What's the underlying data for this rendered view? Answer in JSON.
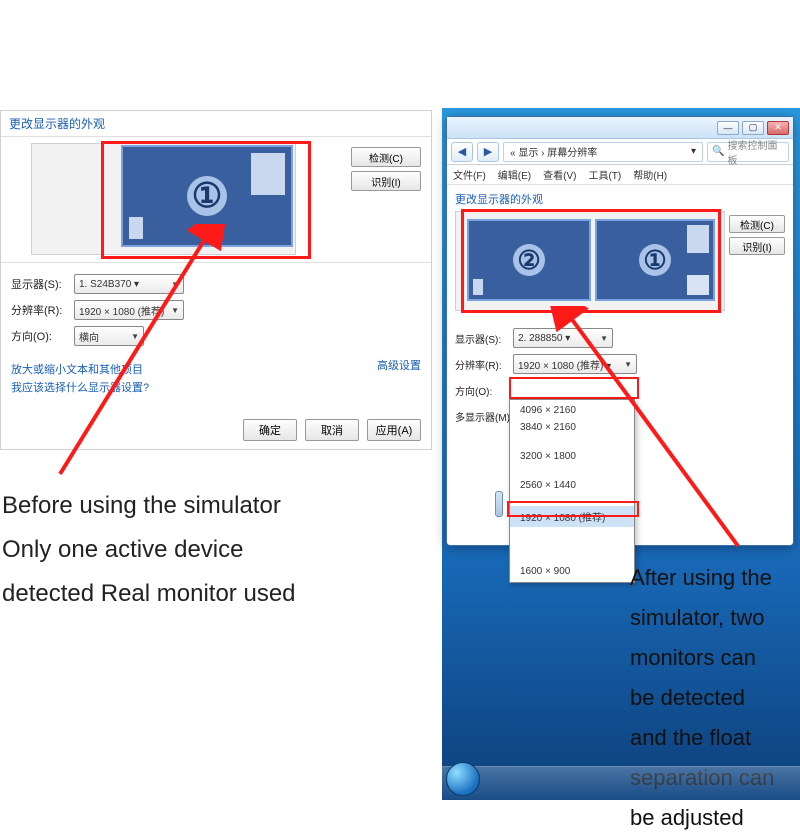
{
  "left": {
    "title": "更改显示器的外观",
    "buttons": {
      "detect": "检测(C)",
      "identify": "识别(I)"
    },
    "fields": {
      "display_label": "显示器(S):",
      "display_value": "1. S24B370 ▾",
      "resolution_label": "分辨率(R):",
      "resolution_value": "1920 × 1080 (推荐)",
      "orientation_label": "方向(O):",
      "orientation_value": "横向"
    },
    "adv_link": "高级设置",
    "help_link1": "放大或缩小文本和其他项目",
    "help_link2": "我应该选择什么显示器设置?",
    "bottom": {
      "ok": "确定",
      "cancel": "取消",
      "apply": "应用(A)"
    }
  },
  "caption_left_l1": "Before using the simulator",
  "caption_left_l2": "Only one active device",
  "caption_left_l3": "detected Real monitor used",
  "right": {
    "breadcrumb": "« 显示 › 屏幕分辨率",
    "search_placeholder": "搜索控制面板",
    "menu": {
      "file": "文件(F)",
      "edit": "编辑(E)",
      "view": "查看(V)",
      "tools": "工具(T)",
      "help": "帮助(H)"
    },
    "section_title": "更改显示器的外观",
    "buttons": {
      "detect": "检测(C)",
      "identify": "识别(I)"
    },
    "fields": {
      "display_label": "显示器(S):",
      "display_value": "2. 288850 ▾",
      "resolution_label": "分辨率(R):",
      "resolution_value": "1920 × 1080 (推荐) ▾",
      "orientation_label": "方向(O):",
      "multi_label": "多显示器(M):"
    },
    "resolutions": [
      "4096 × 2160",
      "3840 × 2160",
      "",
      "3200 × 1800",
      "",
      "2560 × 1440",
      "",
      "1920 × 1080 (推荐)",
      "",
      "",
      "",
      "1600 × 900"
    ]
  },
  "caption_right_l1": "After using the",
  "caption_right_l2": "simulator, two",
  "caption_right_l3": "monitors can",
  "caption_right_l4": "be detected",
  "caption_right_l5": "and the float",
  "caption_right_l6": "separation can",
  "caption_right_l7": "be adjusted"
}
